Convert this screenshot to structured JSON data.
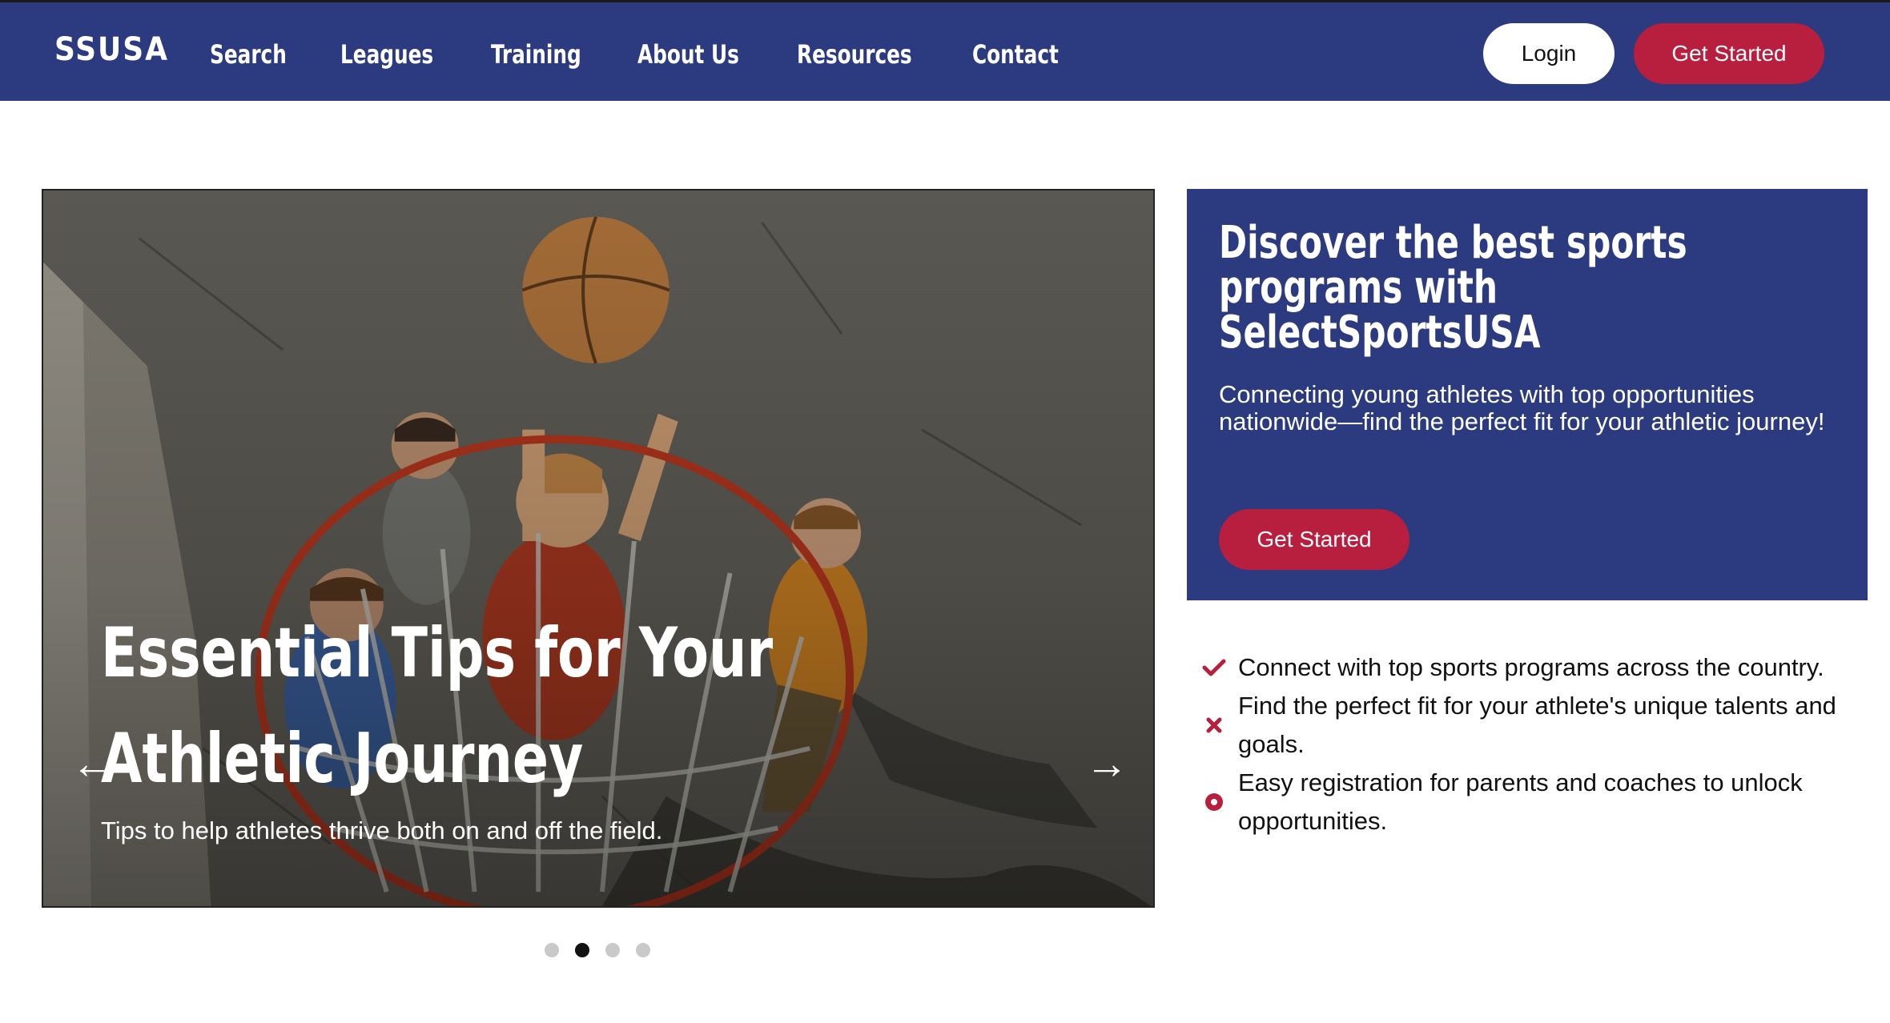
{
  "nav": {
    "logo": "SSUSA",
    "links": [
      "Search",
      "Leagues",
      "Training",
      "About Us",
      "Resources",
      "Contact"
    ],
    "login_label": "Login",
    "get_started_label": "Get Started"
  },
  "carousel": {
    "title": "Essential Tips for Your Athletic Journey",
    "subtitle": "Tips to help athletes thrive both on and off the field.",
    "prev_icon": "arrow-left-icon",
    "next_icon": "arrow-right-icon",
    "slide_count": 4,
    "active_slide": 2
  },
  "promo": {
    "heading": "Discover the best sports programs with SelectSportsUSA",
    "text": "Connecting young athletes with top opportunities nationwide—find the perfect fit for your athletic journey!",
    "button_label": "Get Started"
  },
  "features": [
    {
      "icon": "check-icon",
      "text": "Connect with top sports programs across the country."
    },
    {
      "icon": "x-icon",
      "text": "Find the perfect fit for your athlete's unique talents and goals."
    },
    {
      "icon": "circle-dot-icon",
      "text": "Easy registration for parents and coaches to unlock opportunities."
    }
  ],
  "colors": {
    "navy": "#2c3b7f",
    "crimson": "#b81e3d",
    "white": "#ffffff"
  }
}
